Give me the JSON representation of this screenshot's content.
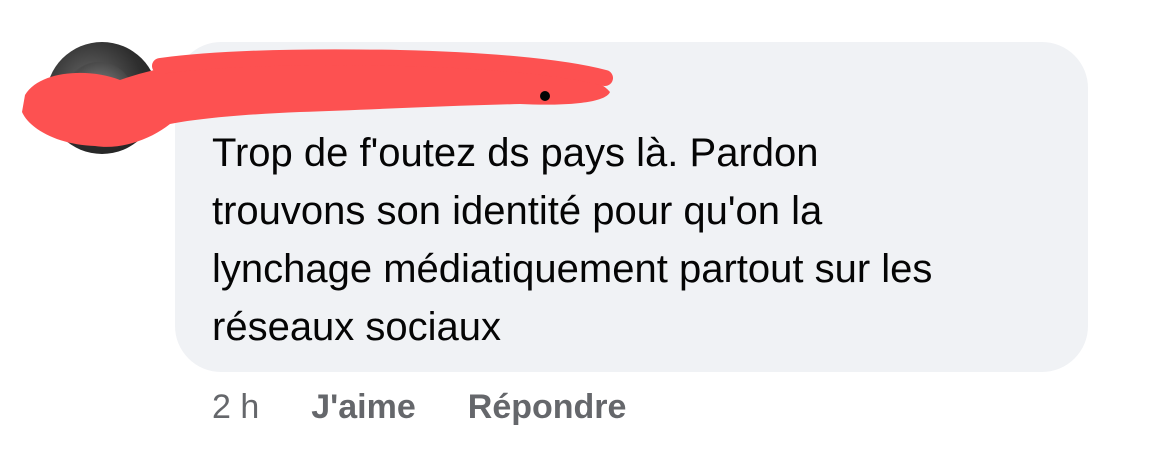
{
  "comment": {
    "author": "",
    "lines": [
      "Trop de f'outez ds pays là. Pardon",
      "trouvons son identité pour qu'on la",
      "lynchage médiatiquement partout sur les",
      "réseaux sociaux"
    ],
    "timestamp": "2 h",
    "like_label": "J'aime",
    "reply_label": "Répondre"
  },
  "colors": {
    "bubble": "#f0f2f5",
    "text": "#050505",
    "secondary_text": "#65676b",
    "redaction": "#fd5151"
  },
  "icons": {
    "avatar": "profile-photo"
  }
}
